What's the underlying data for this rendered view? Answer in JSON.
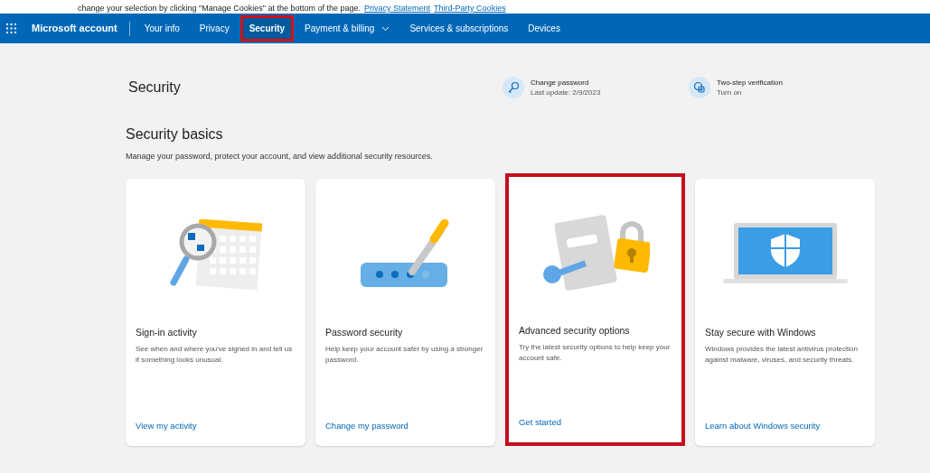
{
  "cookie_banner": {
    "text": "change your selection by clicking \"Manage Cookies\" at the bottom of the page.",
    "links": [
      "Privacy Statement",
      "Third-Party Cookies"
    ]
  },
  "nav": {
    "brand": "Microsoft account",
    "tabs": [
      {
        "label": "Your info",
        "selected": false,
        "highlighted": false,
        "has_menu": false
      },
      {
        "label": "Privacy",
        "selected": false,
        "highlighted": false,
        "has_menu": false
      },
      {
        "label": "Security",
        "selected": true,
        "highlighted": true,
        "has_menu": false
      },
      {
        "label": "Payment & billing",
        "selected": false,
        "highlighted": false,
        "has_menu": true
      },
      {
        "label": "Services & subscriptions",
        "selected": false,
        "highlighted": false,
        "has_menu": false
      },
      {
        "label": "Devices",
        "selected": false,
        "highlighted": false,
        "has_menu": false
      }
    ]
  },
  "page_title": "Security",
  "quick_actions": [
    {
      "kind": "key",
      "title": "Change password",
      "subtitle": "Last update: 2/9/2023"
    },
    {
      "kind": "verify",
      "title": "Two-step verification",
      "subtitle": "Turn on"
    }
  ],
  "section": {
    "title": "Security basics",
    "description": "Manage your password, protect your account, and view additional security resources."
  },
  "cards": [
    {
      "kind": "activity",
      "title": "Sign-in activity",
      "description": "See when and where you've signed in and tell us if something looks unusual.",
      "link": "View my activity",
      "highlighted": false
    },
    {
      "kind": "password",
      "title": "Password security",
      "description": "Help keep your account safer by using a stronger password.",
      "link": "Change my password",
      "highlighted": false
    },
    {
      "kind": "advanced",
      "title": "Advanced security options",
      "description": "Try the latest security options to help keep your account safe.",
      "link": "Get started",
      "highlighted": true
    },
    {
      "kind": "windows",
      "title": "Stay secure with Windows",
      "description": "Windows provides the latest antivirus protection against malware, viruses, and security threats.",
      "link": "Learn about Windows security",
      "highlighted": false
    }
  ]
}
